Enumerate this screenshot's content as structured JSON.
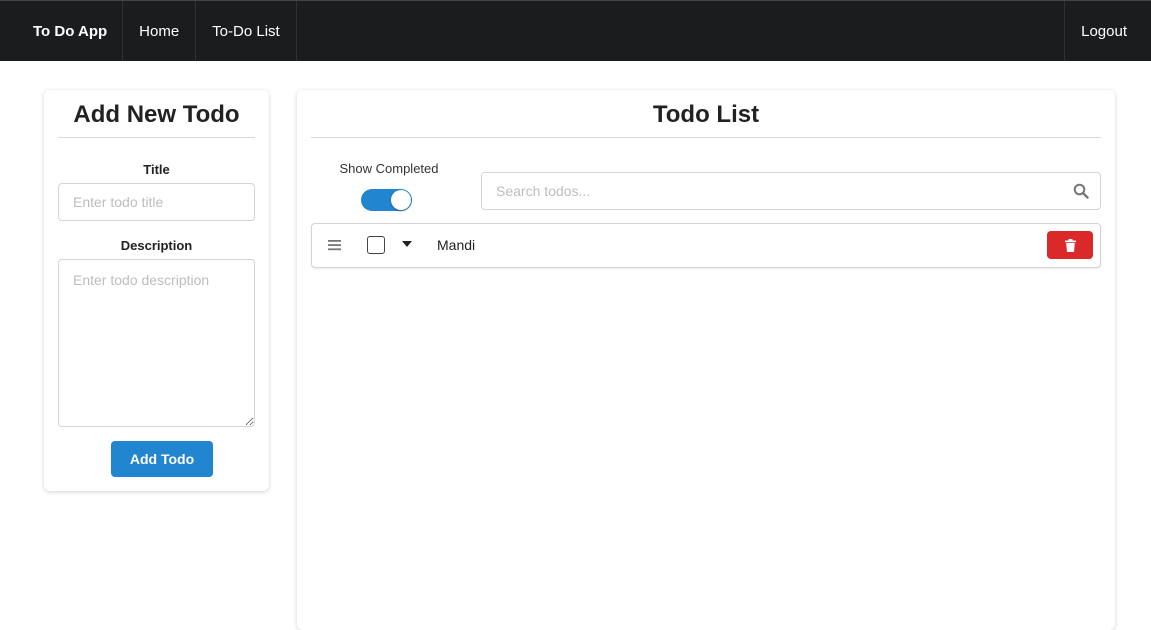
{
  "nav": {
    "brand": "To Do App",
    "home": "Home",
    "todo_list": "To-Do List",
    "logout": "Logout"
  },
  "add_todo": {
    "title": "Add New Todo",
    "title_label": "Title",
    "title_placeholder": "Enter todo title",
    "description_label": "Description",
    "description_placeholder": "Enter todo description",
    "submit_label": "Add Todo"
  },
  "todo_list": {
    "title": "Todo List",
    "show_completed_label": "Show Completed",
    "show_completed": true,
    "search_placeholder": "Search todos...",
    "items": [
      {
        "title": "Mandi",
        "completed": false
      }
    ]
  },
  "colors": {
    "navbar": "#1b1c1d",
    "primary": "#2185d0",
    "danger": "#db2828"
  },
  "icons": [
    "search-icon",
    "drag-handle-icon",
    "caret-down-icon",
    "trash-icon"
  ]
}
